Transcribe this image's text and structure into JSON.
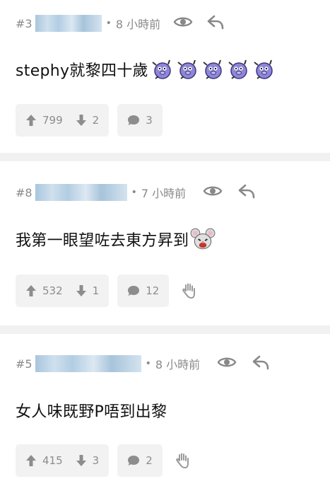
{
  "comments": [
    {
      "floor": "#3",
      "time": "8 小時前",
      "text": "stephy就黎四十歲",
      "emoji": [
        "dancing-pig-emoji",
        "dancing-pig-emoji",
        "dancing-pig-emoji",
        "dancing-pig-emoji",
        "dancing-pig-emoji"
      ],
      "upvotes": "799",
      "downvotes": "2",
      "replies": "3"
    },
    {
      "floor": "#8",
      "time": "7 小時前",
      "text": "我第一眼望咗去東方昇到",
      "emoji": [
        "laughing-mouse-emoji"
      ],
      "upvotes": "532",
      "downvotes": "1",
      "replies": "12"
    },
    {
      "floor": "#5",
      "time": "8 小時前",
      "text": "女人味既野P唔到出黎",
      "emoji": [],
      "upvotes": "415",
      "downvotes": "3",
      "replies": "2"
    }
  ],
  "colors": {
    "icon": "#888888",
    "blur": "#b2cde2",
    "divider": "#f1f1f1"
  }
}
